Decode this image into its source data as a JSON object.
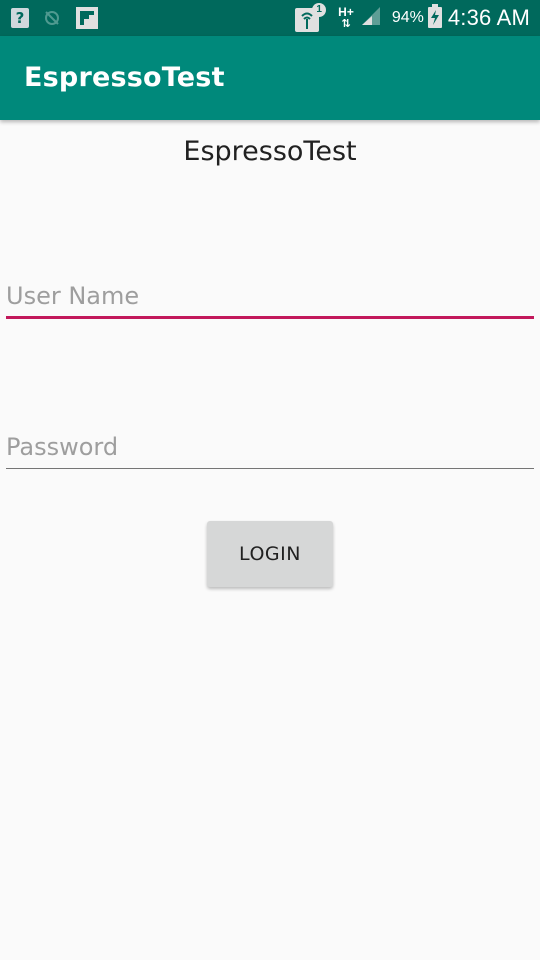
{
  "status_bar": {
    "left_icons": [
      "help-icon",
      "sync-off-icon",
      "flipboard-icon"
    ],
    "notification_badge": "1",
    "network_type": "H+",
    "battery_percent": "94%",
    "time": "4:36 AM"
  },
  "app_bar": {
    "title": "EspressoTest"
  },
  "screen": {
    "title": "EspressoTest",
    "username_field": {
      "placeholder": "User Name",
      "value": ""
    },
    "password_field": {
      "placeholder": "Password",
      "value": ""
    },
    "login_button": {
      "label": "LOGIN"
    }
  },
  "colors": {
    "status_bar": "#00695c",
    "app_bar": "#00897b",
    "accent": "#c2185b",
    "background": "#fafafa",
    "button": "#d6d7d7"
  }
}
